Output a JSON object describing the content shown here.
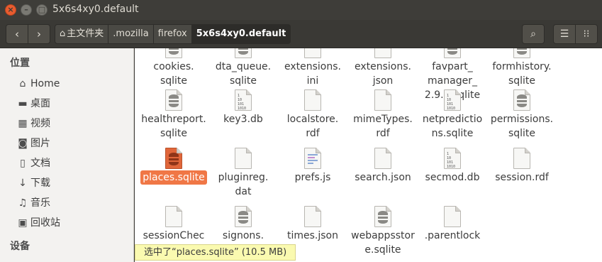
{
  "window": {
    "title": "5x6s4xy0.default"
  },
  "toolbar": {
    "crumbs": [
      {
        "label": "主文件夹"
      },
      {
        "label": ".mozilla"
      },
      {
        "label": "firefox"
      },
      {
        "label": "5x6s4xy0.default"
      }
    ]
  },
  "sidebar": {
    "places_heading": "位置",
    "devices_heading": "设备",
    "items": [
      {
        "label": "Home",
        "icon": "home-icon"
      },
      {
        "label": "桌面",
        "icon": "desktop-icon"
      },
      {
        "label": "视频",
        "icon": "video-icon"
      },
      {
        "label": "图片",
        "icon": "pictures-icon"
      },
      {
        "label": "文档",
        "icon": "documents-icon"
      },
      {
        "label": "下载",
        "icon": "downloads-icon"
      },
      {
        "label": "音乐",
        "icon": "music-icon"
      },
      {
        "label": "回收站",
        "icon": "trash-icon"
      }
    ]
  },
  "files": [
    {
      "name": "cookies.\nsqlite",
      "type": "sqlite"
    },
    {
      "name": "dta_queue.\nsqlite",
      "type": "sqlite"
    },
    {
      "name": "extensions.\nini",
      "type": "text"
    },
    {
      "name": "extensions.\njson",
      "type": "text"
    },
    {
      "name": "favpart_\nmanager_\n2.9.0.sqlite",
      "type": "sqlite"
    },
    {
      "name": "formhistory.\nsqlite",
      "type": "sqlite"
    },
    {
      "name": "healthreport.\nsqlite",
      "type": "sqlite"
    },
    {
      "name": "key3.db",
      "type": "binary"
    },
    {
      "name": "localstore.\nrdf",
      "type": "text"
    },
    {
      "name": "mimeTypes.\nrdf",
      "type": "text"
    },
    {
      "name": "netpredictio\nns.sqlite",
      "type": "binary"
    },
    {
      "name": "permissions.\nsqlite",
      "type": "sqlite"
    },
    {
      "name": "places.sqlite",
      "type": "sqlite-selected",
      "selected": true
    },
    {
      "name": "pluginreg.\ndat",
      "type": "text"
    },
    {
      "name": "prefs.js",
      "type": "script"
    },
    {
      "name": "search.json",
      "type": "text"
    },
    {
      "name": "secmod.db",
      "type": "binary"
    },
    {
      "name": "session.rdf",
      "type": "text"
    },
    {
      "name": "sessionChec",
      "type": "text"
    },
    {
      "name": "signons.",
      "type": "sqlite"
    },
    {
      "name": "times.json",
      "type": "text"
    },
    {
      "name": "webappsstor\ne.sqlite",
      "type": "sqlite"
    },
    {
      "name": ".parentlock",
      "type": "text"
    }
  ],
  "status": {
    "text": "选中了“places.sqlite” (10.5 MB)"
  }
}
